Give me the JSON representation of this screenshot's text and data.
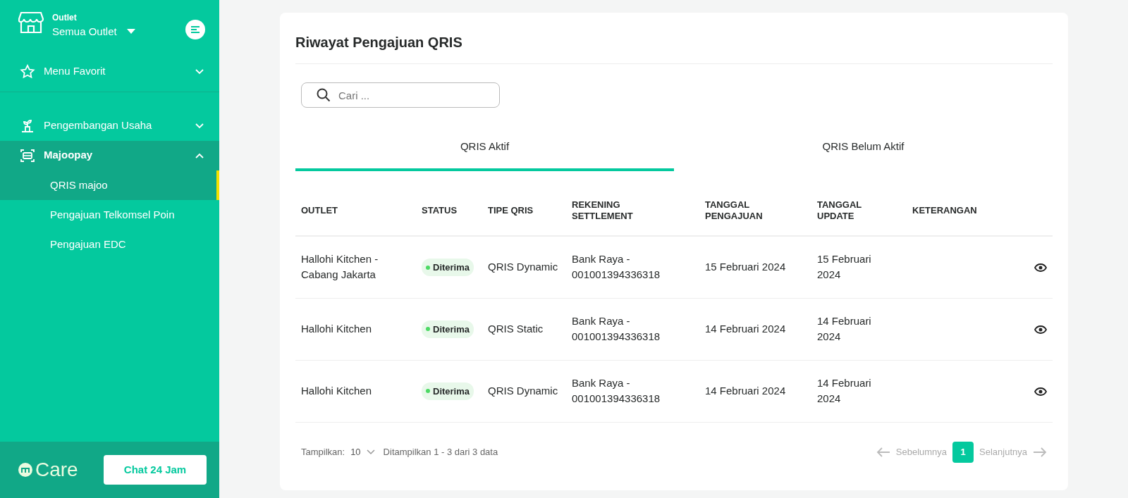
{
  "sidebar": {
    "outlet_label": "Outlet",
    "outlet_value": "Semua Outlet",
    "items": [
      {
        "label": "Menu Favorit",
        "expanded": false,
        "selected": false
      },
      {
        "label": "Pengembangan Usaha",
        "expanded": false,
        "selected": false
      },
      {
        "label": "Majoopay",
        "expanded": true,
        "selected": true,
        "children": [
          {
            "label": "QRIS majoo",
            "selected": true
          },
          {
            "label": "Pengajuan Telkomsel Poin",
            "selected": false
          },
          {
            "label": "Pengajuan EDC",
            "selected": false
          }
        ]
      }
    ],
    "care_logo": "Care",
    "chat_button": "Chat 24 Jam"
  },
  "page": {
    "title": "Riwayat Pengajuan QRIS",
    "search": {
      "placeholder": "Cari ..."
    },
    "tabs": [
      {
        "label": "QRIS Aktif",
        "selected": true
      },
      {
        "label": "QRIS Belum Aktif",
        "selected": false
      }
    ],
    "table": {
      "columns": [
        "OUTLET",
        "STATUS",
        "TIPE QRIS",
        "REKENING SETTLEMENT",
        "TANGGAL PENGAJUAN",
        "TANGGAL UPDATE",
        "KETERANGAN"
      ],
      "rows": [
        {
          "outlet": "Hallohi Kitchen - Cabang Jakarta",
          "status": "Diterima",
          "tipe": "QRIS Dynamic",
          "rekening": "Bank Raya - 001001394336318",
          "tanggal_pengajuan": "15 Februari 2024",
          "tanggal_update": "15 Februari 2024"
        },
        {
          "outlet": "Hallohi Kitchen",
          "status": "Diterima",
          "tipe": "QRIS Static",
          "rekening": "Bank Raya - 001001394336318",
          "tanggal_pengajuan": "14 Februari 2024",
          "tanggal_update": "14 Februari 2024"
        },
        {
          "outlet": "Hallohi Kitchen",
          "status": "Diterima",
          "tipe": "QRIS Dynamic",
          "rekening": "Bank Raya - 001001394336318",
          "tanggal_pengajuan": "14 Februari 2024",
          "tanggal_update": "14 Februari 2024"
        }
      ]
    },
    "footer": {
      "show_label": "Tampilkan:",
      "show_value": "10",
      "summary": "Ditampilkan 1 - 3 dari 3 data",
      "prev": "Sebelumnya",
      "next": "Selanjutnya",
      "pages": [
        {
          "label": "1",
          "selected": true
        }
      ]
    }
  }
}
